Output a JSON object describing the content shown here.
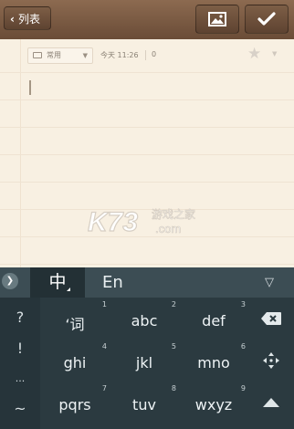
{
  "topbar": {
    "back_label": "列表",
    "back_icon": "chevron-left-icon",
    "image_button_icon": "image-icon",
    "confirm_button_icon": "checkmark-icon"
  },
  "note": {
    "folder": "常用",
    "date": "今天 11:26",
    "count": "0",
    "star_icon": "star-icon"
  },
  "watermark": {
    "logo": "K73",
    "site": "游戏之家",
    "domain": ".com"
  },
  "keyboard": {
    "mode_chinese": "中",
    "mode_english": "En",
    "collapse_icon": "chevron-right-icon",
    "hide_icon": "triangle-down-icon",
    "symbols": [
      "?",
      "!",
      "...",
      "~"
    ],
    "keys": [
      {
        "num": "1",
        "label": "‘词"
      },
      {
        "num": "2",
        "label": "abc"
      },
      {
        "num": "3",
        "label": "def"
      },
      {
        "num": "4",
        "label": "ghi"
      },
      {
        "num": "5",
        "label": "jkl"
      },
      {
        "num": "6",
        "label": "mno"
      },
      {
        "num": "7",
        "label": "pqrs"
      },
      {
        "num": "8",
        "label": "tuv"
      },
      {
        "num": "9",
        "label": "wxyz"
      }
    ],
    "right_icons": [
      "backspace-icon",
      "move-cursor-icon",
      "caret-up-icon"
    ],
    "bg_color": "#2b3a40"
  }
}
